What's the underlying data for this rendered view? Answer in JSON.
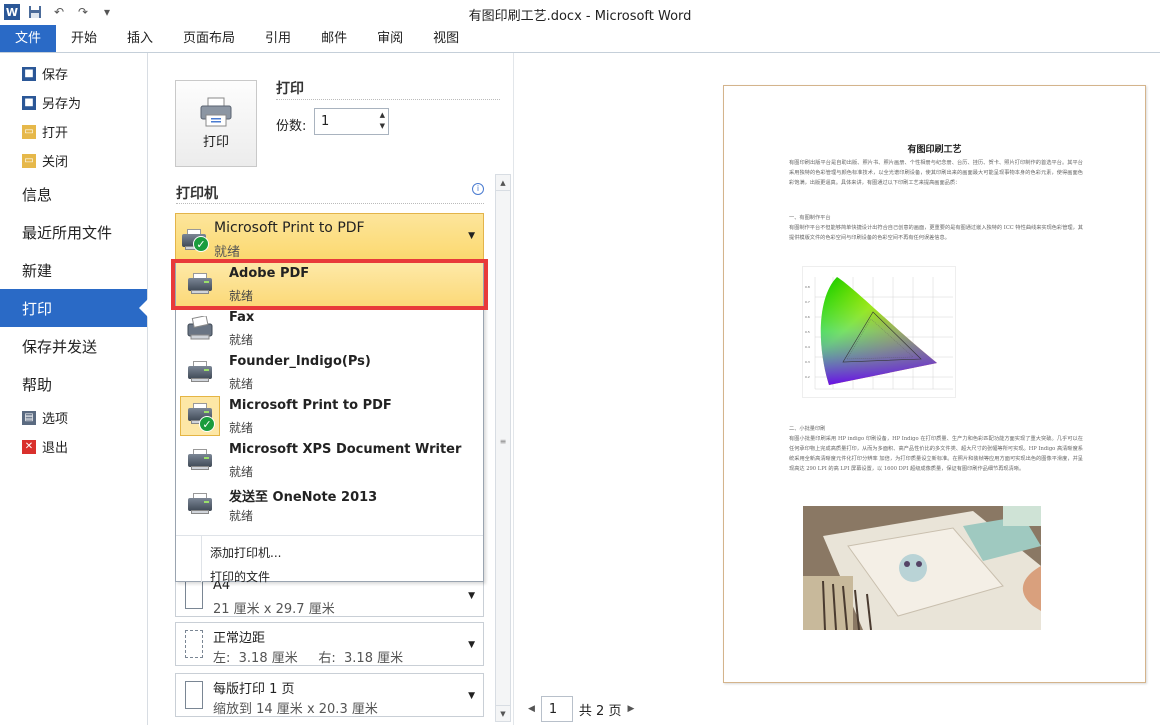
{
  "window": {
    "title": "有图印刷工艺.docx  -  Microsoft Word"
  },
  "qat": {
    "icons": [
      "word-logo",
      "save-icon",
      "undo-icon",
      "redo-icon",
      "customize-icon"
    ]
  },
  "ribbon": {
    "tabs": [
      "文件",
      "开始",
      "插入",
      "页面布局",
      "引用",
      "邮件",
      "审阅",
      "视图"
    ]
  },
  "nav": {
    "small_top": [
      {
        "label": "保存",
        "icon": "save-icon",
        "color": "#2b5797"
      },
      {
        "label": "另存为",
        "icon": "save-as-icon",
        "color": "#2b5797"
      },
      {
        "label": "打开",
        "icon": "open-folder-icon",
        "color": "#e6b84a"
      },
      {
        "label": "关闭",
        "icon": "close-folder-icon",
        "color": "#e6b84a"
      }
    ],
    "big": [
      "信息",
      "最近所用文件",
      "新建",
      "打印",
      "保存并发送",
      "帮助"
    ],
    "active": "打印",
    "small_bottom": [
      {
        "label": "选项",
        "icon": "options-icon",
        "color": "#5a6a80"
      },
      {
        "label": "退出",
        "icon": "exit-icon",
        "color": "#d9302c"
      }
    ]
  },
  "print": {
    "button_label": "打印",
    "title": "打印",
    "copies_label": "份数:",
    "copies_value": "1",
    "printer_heading": "打印机",
    "selected_printer": {
      "name": "Microsoft Print to PDF",
      "status": "就绪"
    },
    "printers": [
      {
        "name": "Adobe PDF",
        "status": "就绪",
        "highlighted": true
      },
      {
        "name": "Fax",
        "status": "就绪"
      },
      {
        "name": "Founder_Indigo(Ps)",
        "status": "就绪"
      },
      {
        "name": "Microsoft Print to PDF",
        "status": "就绪",
        "default": true
      },
      {
        "name": "Microsoft XPS Document Writer",
        "status": "就绪"
      },
      {
        "name": "发送至 OneNote 2013",
        "status": "就绪"
      }
    ],
    "add_printer": "添加打印机...",
    "print_to_file": "打印的文件",
    "paper": {
      "title": "A4",
      "sub": "21 厘米 x 29.7 厘米"
    },
    "margins": {
      "title": "正常边距",
      "sub": "左:  3.18 厘米     右:  3.18 厘米"
    },
    "pages_per_sheet": {
      "title": "每版打印 1 页",
      "sub": "缩放到 14 厘米 x 20.3 厘米"
    },
    "highlight_color": "#e83a3a"
  },
  "preview": {
    "doc_title": "有图印刷工艺",
    "intro": "有图印刷出版平台是自助出版、照片书、照片画册、个性相册与纪念册、台历、挂历、贺卡、照片打印制作的首选平台。其平台采用独特的色彩管理与颜色标准技术，以全光谱印刷设备，使其印刷出来的画面最大可能呈现事物本身的色彩元素，使得画面色彩饱满，出版更逼真。具体来讲，有图通过以下印刷工艺来提高画面品质：",
    "section1_title": "一、有图制作平台",
    "section1": "有图制作平台不但能够简单快捷设计出符合自己创意的画面，更重要的是有图通过嵌入独特的 ICC 特性曲线来实现色彩管理，其提供模版文件的色彩空间与印刷设备的色彩空间不再有任何误差信息。",
    "section2_title": "二、小批量印刷",
    "section2": "有图小批量印刷采用 HP indigo 印刷设备，HP Indigo 在打印质量、生产力和色彩匹配功能方面实现了重大突破。几乎可以在任何承印物上完成高质量打印，从而为多面积、高产品性价比的多文件类、超大尺寸的张幅等所可实现。HP Indigo 高清晰度系统采用全新高清晰度元件化打印分辨率 加倍，为打印质量设立新标准。在照片和装帧等应用方面可实现出色的图像平滑度，并呈现高达 290 LPI 的高 LPI 屏幕设置，以 1600 DPI 超级成像质量，保证有图印刷作品细节再现清晰。",
    "current_page": "1",
    "total_pages": "共 2 页"
  }
}
